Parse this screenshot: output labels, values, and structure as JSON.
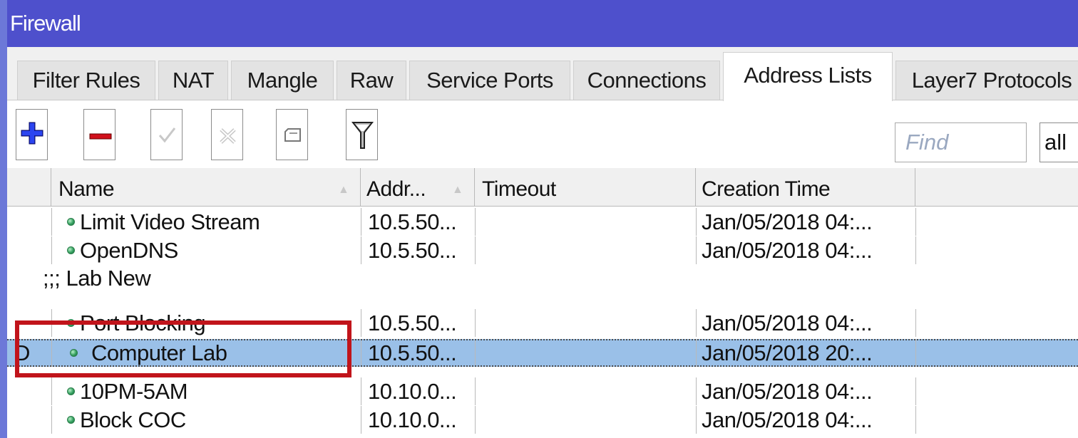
{
  "window": {
    "title": "Firewall"
  },
  "tabs": [
    {
      "label": "Filter Rules"
    },
    {
      "label": "NAT"
    },
    {
      "label": "Mangle"
    },
    {
      "label": "Raw"
    },
    {
      "label": "Service Ports"
    },
    {
      "label": "Connections"
    },
    {
      "label": "Address Lists",
      "active": true
    },
    {
      "label": "Layer7 Protocols"
    }
  ],
  "toolbar": {
    "add_icon": "plus-icon",
    "remove_icon": "minus-icon",
    "enable_icon": "checkmark-icon",
    "disable_icon": "cross-icon",
    "comment_icon": "comment-icon",
    "filter_icon": "funnel-icon",
    "find_placeholder": "Find",
    "scope_value": "all"
  },
  "table": {
    "columns": [
      {
        "label": ""
      },
      {
        "label": "Name"
      },
      {
        "label": "Addr..."
      },
      {
        "label": "Timeout"
      },
      {
        "label": "Creation Time"
      }
    ],
    "rows": [
      {
        "flag": "",
        "name": "Limit Video Stream",
        "address": "10.5.50...",
        "timeout": "",
        "creation_time": "Jan/05/2018 04:..."
      },
      {
        "flag": "",
        "name": "OpenDNS",
        "address": "10.5.50...",
        "timeout": "",
        "creation_time": "Jan/05/2018 04:..."
      },
      {
        "comment": ";;; Lab New"
      },
      {
        "flag": "",
        "name": "Port Blocking",
        "address": "10.5.50...",
        "timeout": "",
        "creation_time": "Jan/05/2018 04:..."
      },
      {
        "flag": "D",
        "name": "Computer Lab",
        "address": "10.5.50...",
        "timeout": "",
        "creation_time": "Jan/05/2018 20:...",
        "selected": true
      },
      {
        "flag": "",
        "name": "10PM-5AM",
        "address": "10.10.0...",
        "timeout": "",
        "creation_time": "Jan/05/2018 04:..."
      },
      {
        "flag": "",
        "name": "Block COC",
        "address": "10.10.0...",
        "timeout": "",
        "creation_time": "Jan/05/2018 04:..."
      }
    ]
  },
  "colors": {
    "titlebar": "#4e50cc",
    "selected_row": "#9ac0e8",
    "highlight_box": "#c1141b",
    "status_dot": "#34a060"
  }
}
